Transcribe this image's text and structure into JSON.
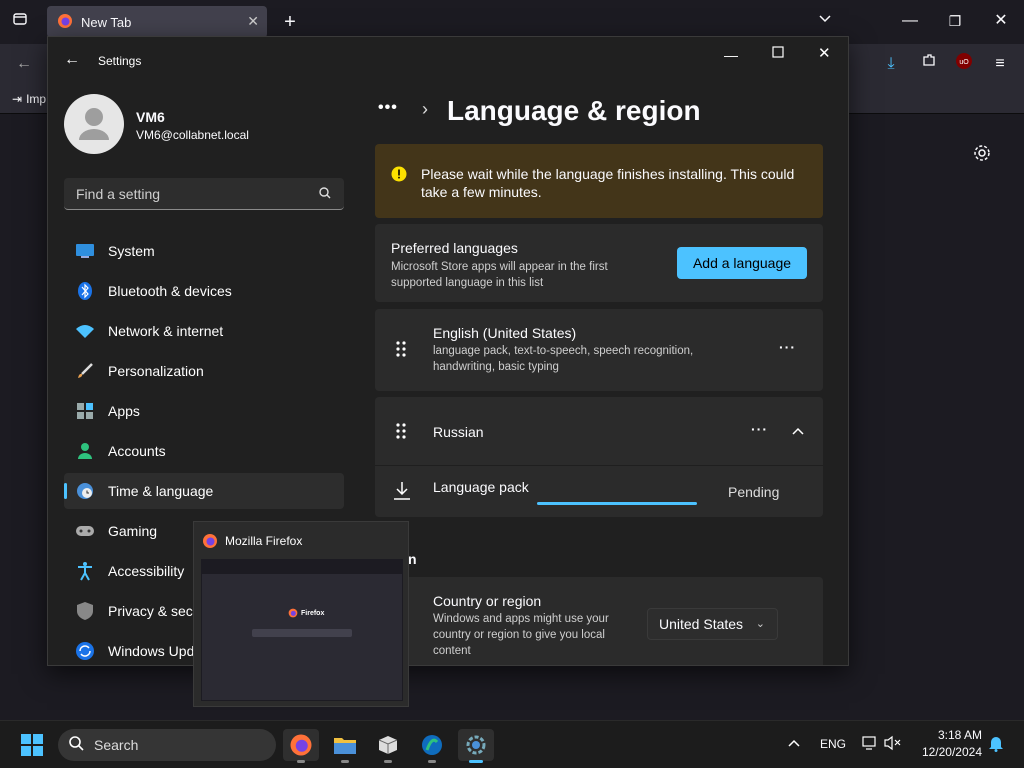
{
  "browser": {
    "tab_title": "New Tab",
    "bookmark_import": "Imp"
  },
  "settings": {
    "window_title": "Settings",
    "user": {
      "name": "VM6",
      "email": "VM6@collabnet.local"
    },
    "search_placeholder": "Find a setting",
    "nav": [
      {
        "label": "System",
        "icon": "system-icon"
      },
      {
        "label": "Bluetooth & devices",
        "icon": "bluetooth-icon"
      },
      {
        "label": "Network & internet",
        "icon": "wifi-icon"
      },
      {
        "label": "Personalization",
        "icon": "brush-icon"
      },
      {
        "label": "Apps",
        "icon": "apps-icon"
      },
      {
        "label": "Accounts",
        "icon": "person-icon"
      },
      {
        "label": "Time & language",
        "icon": "clock-globe-icon",
        "selected": true
      },
      {
        "label": "Gaming",
        "icon": "gamepad-icon"
      },
      {
        "label": "Accessibility",
        "icon": "accessibility-icon"
      },
      {
        "label": "Privacy & secu",
        "icon": "shield-icon"
      },
      {
        "label": "Windows Upd",
        "icon": "update-icon"
      }
    ],
    "page": {
      "breadcrumb_more": "•••",
      "title": "Language & region",
      "warning": "Please wait while the language finishes installing. This could take a few minutes.",
      "preferred": {
        "title": "Preferred languages",
        "desc": "Microsoft Store apps will appear in the first supported language in this list",
        "add_button": "Add a language"
      },
      "languages": [
        {
          "name": "English (United States)",
          "features": "language pack, text-to-speech, speech recognition, handwriting, basic typing"
        },
        {
          "name": "Russian"
        }
      ],
      "language_pack": {
        "label": "Language pack",
        "status": "Pending",
        "progress": 0.65
      },
      "region_heading_partial": "n",
      "country": {
        "title": "Country or region",
        "desc": "Windows and apps might use your country or region to give you local content",
        "value": "United States"
      }
    }
  },
  "thumbnail": {
    "title": "Mozilla Firefox",
    "mini_logo": "Firefox"
  },
  "taskbar": {
    "search_label": "Search",
    "lang": "ENG",
    "time": "3:18 AM",
    "date": "12/20/2024"
  },
  "colors": {
    "accent": "#4cc2ff",
    "warning_bg": "#433519",
    "warning_icon": "#fce100"
  }
}
